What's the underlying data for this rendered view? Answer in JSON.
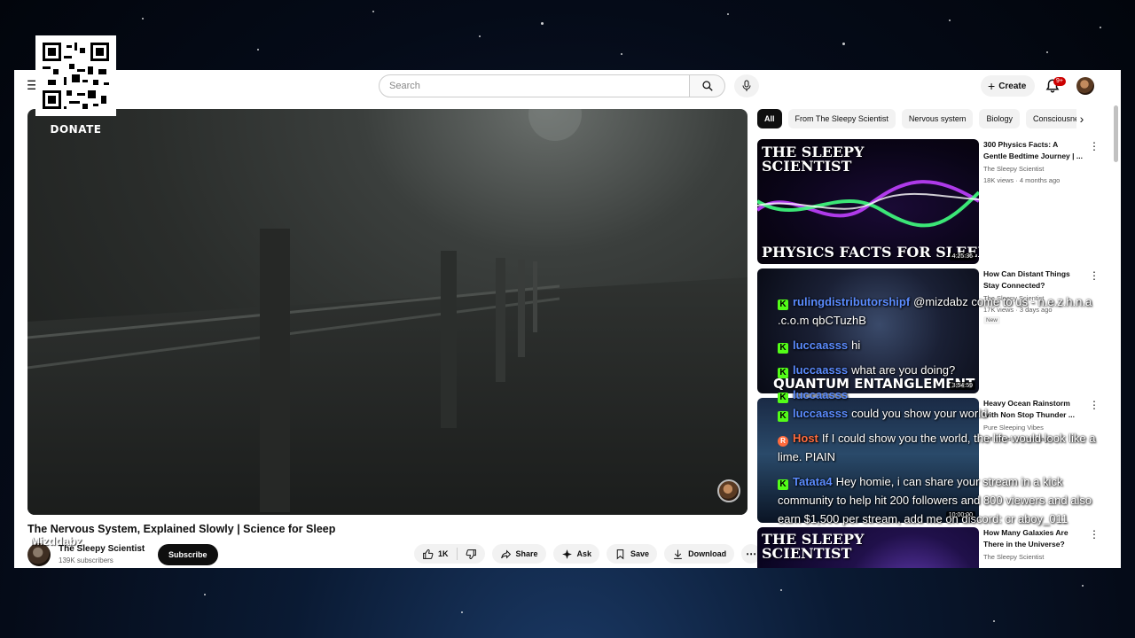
{
  "donate": {
    "label": "DONATE"
  },
  "header": {
    "search_placeholder": "Search",
    "create_label": "Create",
    "notification_count": "9+"
  },
  "video": {
    "title": "The Nervous System, Explained Slowly | Science for Sleep",
    "channel": "The Sleepy Scientist",
    "subscribers": "139K subscribers",
    "subscribe_label": "Subscribe",
    "likes": "1K",
    "actions": {
      "share": "Share",
      "ask": "Ask",
      "save": "Save",
      "download": "Download"
    }
  },
  "chips": [
    "All",
    "From The Sleepy Scientist",
    "Nervous system",
    "Biology",
    "Consciousness"
  ],
  "recommendations": [
    {
      "title": "300 Physics Facts: A Gentle Bedtime Journey | ...",
      "channel": "The Sleepy Scientist",
      "meta": "18K views · 4 months ago",
      "thumb_top": "THE SLEEPY SCIENTIST",
      "thumb_bottom": "PHYSICS FACTS FOR SLEEP",
      "duration": "4:25:36"
    },
    {
      "title": "How Can Distant Things Stay Connected?",
      "channel": "The Sleepy Scientist",
      "meta": "17K views · 3 days ago",
      "badge": "New",
      "thumb_bottom": "QUANTUM ENTANGLEMENT",
      "duration": "3:54:59"
    },
    {
      "title": "Heavy Ocean Rainstorm with Non Stop Thunder ...",
      "channel": "Pure Sleeping Vibes",
      "meta": "8M views · 2 years ago",
      "duration": "10:00:00"
    },
    {
      "title": "How Many Galaxies Are There in the Universe?",
      "channel": "The Sleepy Scientist",
      "meta": "",
      "thumb_top": "THE SLEEPY SCIENTIST"
    }
  ],
  "chat": [
    {
      "user": "rulingdistributorshipf",
      "text": "@mizdabz come to us - n.e.z.h.n.a .c.o.m qbCTuzhB",
      "badge": "K"
    },
    {
      "user": "luccaasss",
      "text": "hi",
      "badge": "K"
    },
    {
      "user": "luccaasss",
      "text": "what are you doing?",
      "badge": "K"
    },
    {
      "user": "luccaasss",
      "text": "",
      "badge": "K"
    },
    {
      "user": "luccaasss",
      "text": "could you show your world",
      "badge": "K"
    },
    {
      "user": "Host",
      "text": "If I could show you the world, the life would look like a lime. PIAIN",
      "badge": "R"
    },
    {
      "user": "Tatata4",
      "text": "Hey homie, i can share your stream in a kick community to help hit 200 followers and 800 viewers and also earn $1,500 per stream, add me on discord: cr aboy_011",
      "badge": "K"
    }
  ],
  "watermark": "Mizddabz"
}
